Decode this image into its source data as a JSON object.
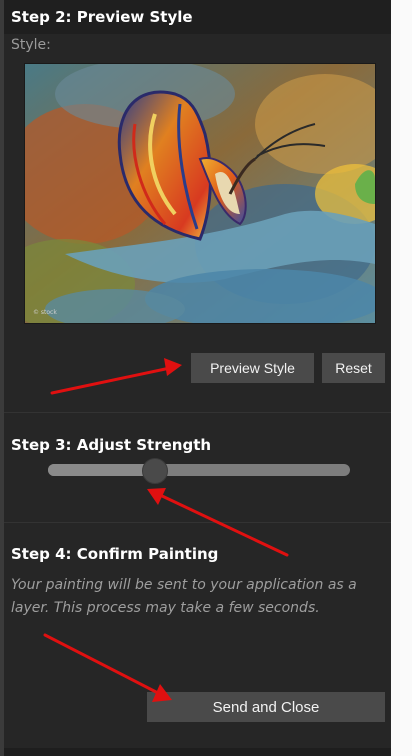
{
  "step2": {
    "title": "Step 2: Preview Style",
    "style_label": "Style:"
  },
  "preview_image": {
    "label": "butterfly-painting-preview",
    "watermark": "© stock"
  },
  "buttons": {
    "preview": "Preview Style",
    "reset": "Reset",
    "send": "Send and Close"
  },
  "step3": {
    "title": "Step 3: Adjust Strength",
    "strength_fraction": 0.35
  },
  "step4": {
    "title": "Step 4: Confirm Painting",
    "description": "Your painting will be sent to your application as a layer. This process may take a few seconds."
  },
  "colors": {
    "panel": "#262626",
    "button": "#4a4a4a",
    "arrow": "#e01010"
  }
}
